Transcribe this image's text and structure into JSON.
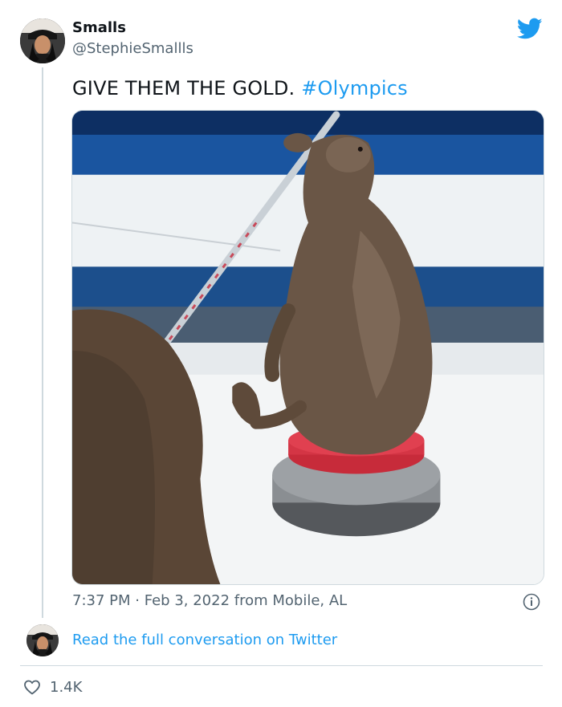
{
  "user": {
    "display_name": "Smalls",
    "handle": "@StephieSmallls"
  },
  "tweet": {
    "text_main": "GIVE THEM THE GOLD.",
    "hashtag": "#Olympics",
    "media_icon": "otter-curling-video"
  },
  "meta": {
    "time": "7:37 PM",
    "separator": "·",
    "date": "Feb 3, 2022",
    "source": "from Mobile, AL"
  },
  "footer": {
    "read_link": "Read the full conversation on Twitter",
    "like_count": "1.4K"
  },
  "colors": {
    "accent": "#1d9bf0",
    "secondary_text": "#536471",
    "divider": "#cfd9de"
  },
  "icons": {
    "brand": "twitter-bird-icon",
    "info": "info-icon",
    "like": "heart-icon"
  }
}
